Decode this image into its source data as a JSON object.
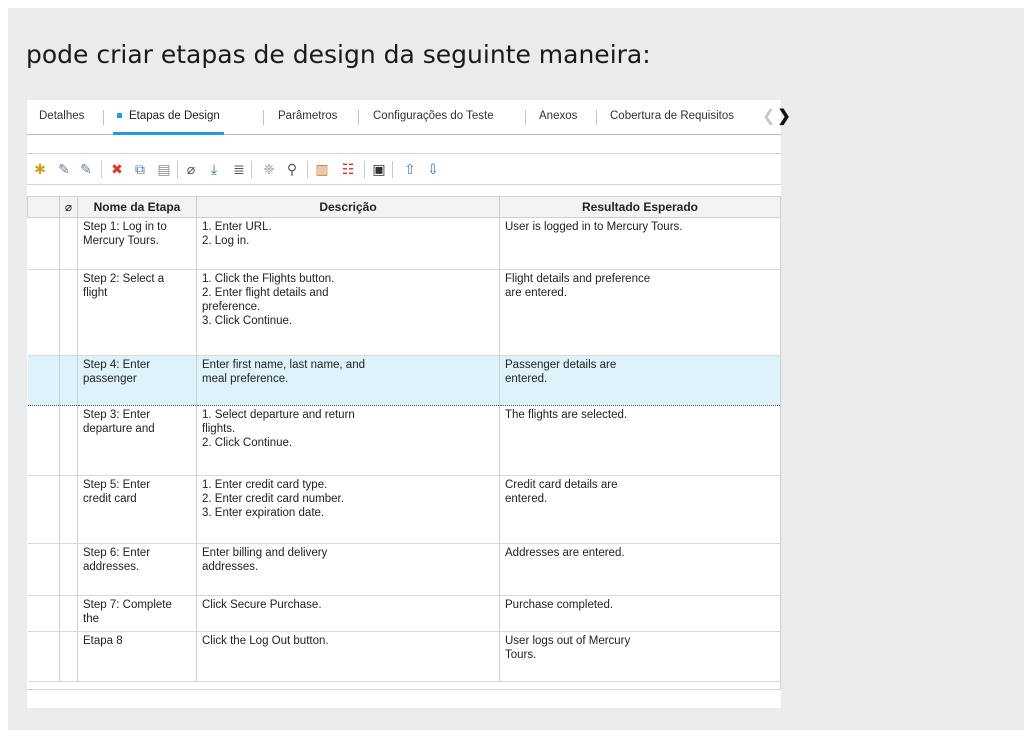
{
  "heading": "pode criar etapas de design da seguinte maneira:",
  "tabs": [
    {
      "label": "Detalhes"
    },
    {
      "label": "Etapas de Design",
      "active": true
    },
    {
      "label": "Parâmetros"
    },
    {
      "label": "Configurações do Teste"
    },
    {
      "label": "Anexos"
    },
    {
      "label": "Cobertura de Requisitos"
    }
  ],
  "tab_nav": {
    "left": "❮",
    "right": "❯"
  },
  "toolbar": [
    {
      "name": "new-step-icon",
      "glyph": "✱",
      "color": "#c7a21b"
    },
    {
      "name": "edit-step-icon",
      "glyph": "✎",
      "color": "#6b7d94"
    },
    {
      "name": "renumber-steps-icon",
      "glyph": "✎",
      "color": "#6b7d94"
    },
    {
      "name": "delete-icon",
      "glyph": "✖",
      "color": "#d83a2a"
    },
    {
      "name": "copy-icon",
      "glyph": "⧉",
      "color": "#4e7ab7"
    },
    {
      "name": "paste-icon",
      "glyph": "▤",
      "color": "#8a8a8a"
    },
    {
      "name": "attachment-icon",
      "glyph": "⌀",
      "color": "#555555"
    },
    {
      "name": "call-to-test-icon",
      "glyph": "⤓",
      "color": "#2f8a3a"
    },
    {
      "name": "insert-parameter-icon",
      "glyph": "≣",
      "color": "#555555"
    },
    {
      "name": "generate-script-icon",
      "glyph": "❈",
      "color": "#9a9a9a"
    },
    {
      "name": "find-icon",
      "glyph": "⚲",
      "color": "#555555"
    },
    {
      "name": "select-columns-icon",
      "glyph": "▥",
      "color": "#c8742a"
    },
    {
      "name": "set-filter-icon",
      "glyph": "☷",
      "color": "#c0392b"
    },
    {
      "name": "save-icon",
      "glyph": "▣",
      "color": "#333333"
    },
    {
      "name": "move-up-icon",
      "glyph": "⇧",
      "color": "#3b6fc2"
    },
    {
      "name": "move-down-icon",
      "glyph": "⇩",
      "color": "#3b6fc2"
    }
  ],
  "grid": {
    "attachment_header_icon": "⌀",
    "columns": [
      "Nome da Etapa",
      "Descrição",
      "Resultado Esperado"
    ],
    "rows": [
      {
        "name": "Step 1: Log in to\nMercury Tours.",
        "description": "1. Enter URL.\n2. Log in.",
        "expected": "User is logged in to Mercury Tours.",
        "h": 52
      },
      {
        "name": "Step 2: Select a\nflight",
        "description": "1. Click the Flights button.\n2. Enter flight details and\npreference.\n3. Click Continue.",
        "expected": "Flight details and preference\nare entered.",
        "h": 86
      },
      {
        "name": "Step 4: Enter\npassenger",
        "description": "Enter first name, last name, and\nmeal preference.",
        "expected": "Passenger details are\nentered.",
        "h": 50,
        "active": true
      },
      {
        "name": "Step 3: Enter\ndeparture and",
        "description": "1. Select departure and return\nflights.\n2. Click Continue.",
        "expected": "The flights are selected.",
        "h": 70
      },
      {
        "name": "Step 5: Enter\ncredit card",
        "description": "1. Enter credit card type.\n2. Enter credit card number.\n3. Enter expiration date.",
        "expected": "Credit card details are\nentered.",
        "h": 68
      },
      {
        "name": "Step 6: Enter\naddresses.",
        "description": "Enter billing and delivery\naddresses.",
        "expected": "Addresses are entered.",
        "h": 52
      },
      {
        "name": "Step 7: Complete\nthe",
        "description": "Click Secure Purchase.",
        "expected": "Purchase completed.",
        "h": 36
      },
      {
        "name": "Etapa 8",
        "description": "Click the Log Out button.",
        "expected": "User logs out of Mercury\nTours.",
        "h": 50
      }
    ]
  }
}
